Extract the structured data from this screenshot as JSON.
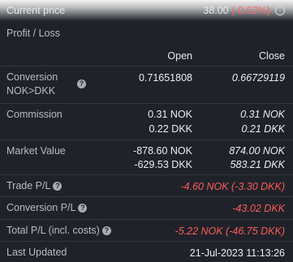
{
  "current_price": {
    "label": "Current price",
    "value": "38.00",
    "change": "(-0.52%)"
  },
  "section_title": "Profit / Loss",
  "columns": {
    "open": "Open",
    "close": "Close"
  },
  "rows": {
    "conversion": {
      "label_line1": "Conversion",
      "label_line2": "NOK>DKK",
      "open": "0.71651808",
      "close": "0.66729119"
    },
    "commission": {
      "label": "Commission",
      "open_1": "0.31 NOK",
      "open_2": "0.22 DKK",
      "close_1": "0.31 NOK",
      "close_2": "0.21 DKK"
    },
    "market_value": {
      "label": "Market Value",
      "open_1": "-878.60 NOK",
      "open_2": "-629.53 DKK",
      "close_1": "874.00 NOK",
      "close_2": "583.21 DKK"
    },
    "trade_pl": {
      "label": "Trade P/L",
      "value": "-4.60 NOK (-3.30 DKK)"
    },
    "conversion_pl": {
      "label": "Conversion P/L",
      "value": "-43.02 DKK"
    },
    "total_pl": {
      "label": "Total P/L (incl. costs)",
      "value": "-5.22 NOK (-46.75 DKK)"
    },
    "last_updated": {
      "label": "Last Updated",
      "value": "21-Jul-2023 11:13:26"
    }
  },
  "colors": {
    "background": "#1f2329",
    "negative": "#ff5a5a",
    "text": "#eceef0"
  }
}
